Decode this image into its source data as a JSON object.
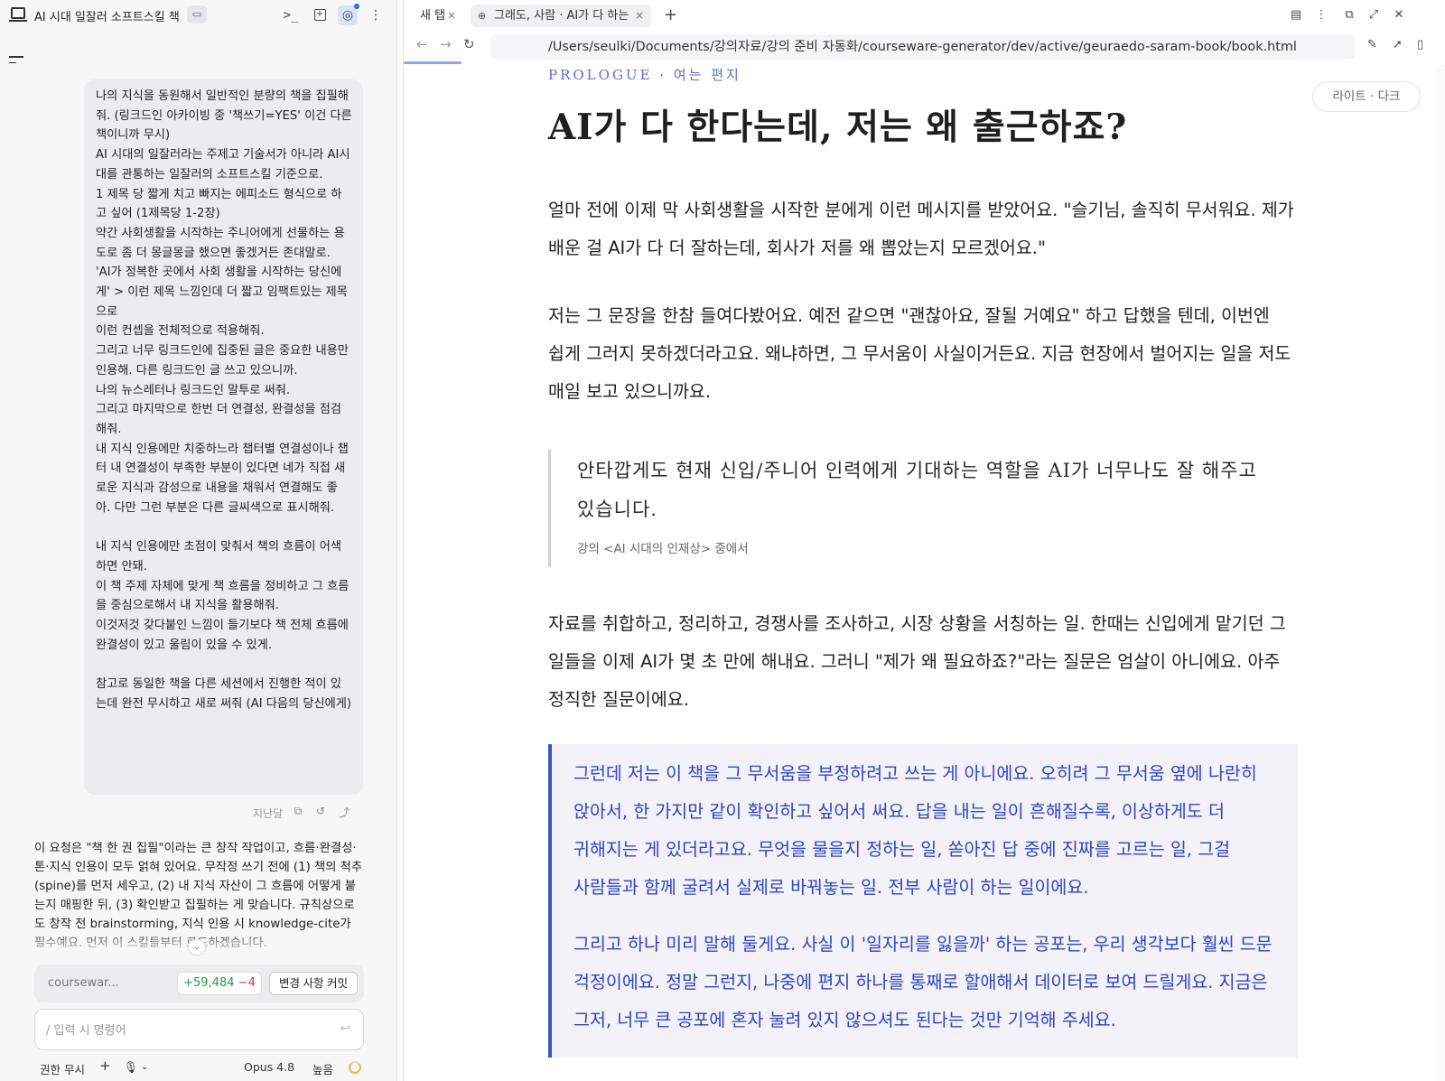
{
  "chat": {
    "title": "AI 시대 일잘러 소프트스킬 책",
    "folder_icon": "folder-icon",
    "header_icons": [
      "terminal-icon",
      "new-file-icon",
      "globe-icon",
      "more-vert-icon"
    ],
    "user_message": "나의 지식을 동원해서 일반적인 분량의 책을 집필해줘. (링크드인 아카이빙 중 '책쓰기=YES' 이건 다른 책이니까 무시)\nAI 시대의 일잘러라는 주제고 기술서가 아니라 AI시대를 관통하는 일잘러의 소프트스킬 기준으로.\n1 제목 당 짧게 치고 빠지는 에피소드 형식으로 하고 싶어 (1제목당 1-2장)\n약간 사회생활을 시작하는 주니어에게 선물하는 용도로 좀 더 몽글몽글 했으면 좋겠거든 존대말로.\n'AI가 정복한 곳에서 사회 생활을 시작하는 당신에게' > 이런 제목 느낌인데 더 짧고 임팩트있는 제목으로\n이런 컨셉을 전체적으로 적용해줘.\n그리고 너무 링크드인에 집중된 글은 중요한 내용만 인용해. 다른 링크드인 글 쓰고 있으니까.\n나의 뉴스레터나 링크드인 말투로 써줘.\n그리고 마지막으로 한번 더 연결성, 완결성을 점검해줘.\n내 지식 인용에만 치중하느라 챕터별 연결성이나 챕터 내 연결성이 부족한 부분이 있다면 네가 직접 새로운 지식과 감성으로 내용을 채워서 연결해도 좋아. 다만 그런 부분은 다른 글씨색으로 표시해줘.\n\n내 지식 인용에만 초점이 맞춰서 책의 흐름이 어색하면 안돼.\n이 책 주제 자체에 맞게 책 흐름을 정비하고 그 흐름을 중심으로해서 내 지식을 활용해줘.\n이것저것 갖다붙인 느낌이 들기보다 책 전체 흐름에 완결성이 있고 울림이 있을 수 있게.\n\n참고로 동일한 책을 다른 세션에서 진행한 적이 있는데 완전 무시하고 새로 써줘 (AI 다음의 당신에게)",
    "message_time": "지난달",
    "message_actions": [
      "copy-icon",
      "undo-icon",
      "share-icon"
    ],
    "assistant_reply": "이 요청은 \"책 한 권 집필\"이라는 큰 창작 작업이고, 흐름·완결성·톤·지식 인용이 모두 얽혀 있어요. 무작정 쓰기 전에 (1) 책의 척추(spine)를 먼저 세우고, (2) 내 지식 자산이 그 흐름에 어떻게 붙는지 매핑한 뒤, (3) 확인받고 집필하는 게 맞습니다. 규칙상으로도 창작 전 brainstorming, 지식 인용 시 knowledge-cite가 필수예요. 먼저 이 스킬들부터 로드하겠습니다.",
    "git": {
      "repo": "coursewar...",
      "additions": "+59,484",
      "deletions": "−4",
      "commit_label": "변경 사항 커밋"
    },
    "input_placeholder": "/ 입력 시 명령어",
    "bottom": {
      "permission": "권한 무시",
      "model": "Opus 4.8",
      "effort": "높음"
    }
  },
  "browser": {
    "tabs": [
      {
        "label": "새 탭"
      },
      {
        "label": "그래도, 사람 · AI가 다 하는 세상에서"
      }
    ],
    "url": "/Users/seulki/Documents/강의자료/강의 준비 자동화/courseware-generator/dev/active/geuraedo-saram-book/book.html",
    "theme_toggle": "라이트 · 다크",
    "page": {
      "eyebrow": "PROLOGUE · 여는 편지",
      "title": "AI가 다 한다는데, 저는 왜 출근하죠?",
      "p1": "얼마 전에 이제 막 사회생활을 시작한 분에게 이런 메시지를 받았어요. \"슬기님, 솔직히 무서워요. 제가 배운 걸 AI가 다 더 잘하는데, 회사가 저를 왜 뽑았는지 모르겠어요.\"",
      "p2": "저는 그 문장을 한참 들여다봤어요. 예전 같으면 \"괜찮아요, 잘될 거예요\" 하고 답했을 텐데, 이번엔 쉽게 그러지 못하겠더라고요. 왜냐하면, 그 무서움이 사실이거든요. 지금 현장에서 벌어지는 일을 저도 매일 보고 있으니까요.",
      "quote": "안타깝게도 현재 신입/주니어 인력에게 기대하는 역할을 AI가 너무나도 잘 해주고 있습니다.",
      "quote_source": "강의 <AI 시대의 인재상> 중에서",
      "p3": "자료를 취합하고, 정리하고, 경쟁사를 조사하고, 시장 상황을 서칭하는 일. 한때는 신입에게 맡기던 그 일들을 이제 AI가 몇 초 만에 해내요. 그러니 \"제가 왜 필요하죠?\"라는 질문은 엄살이 아니에요. 아주 정직한 질문이에요.",
      "callout_1": "그런데 저는 이 책을 그 무서움을 부정하려고 쓰는 게 아니에요. 오히려 그 무서움 옆에 나란히 앉아서, 한 가지만 같이 확인하고 싶어서 써요. 답을 내는 일이 흔해질수록, 이상하게도 더 귀해지는 게 있더라고요. 무엇을 물을지 정하는 일, 쏟아진 답 중에 진짜를 고르는 일, 그걸 사람들과 함께 굴려서 실제로 바꿔놓는 일. 전부 사람이 하는 일이에요.",
      "callout_2": "그리고 하나 미리 말해 둘게요. 사실 이 '일자리를 잃을까' 하는 공포는, 우리 생각보다 훨씬 드문 걱정이에요. 정말 그런지, 나중에 편지 하나를 통째로 할애해서 데이터로 보여 드릴게요. 지금은 그저, 너무 큰 공포에 혼자 눌려 있지 않으셔도 된다는 것만 기억해 주세요."
    },
    "colors": {
      "accent_blue": "#3a51c9",
      "eyebrow_blue": "#5b6fcf",
      "diff_add": "#1f9d4a",
      "diff_del": "#d6333b"
    }
  }
}
